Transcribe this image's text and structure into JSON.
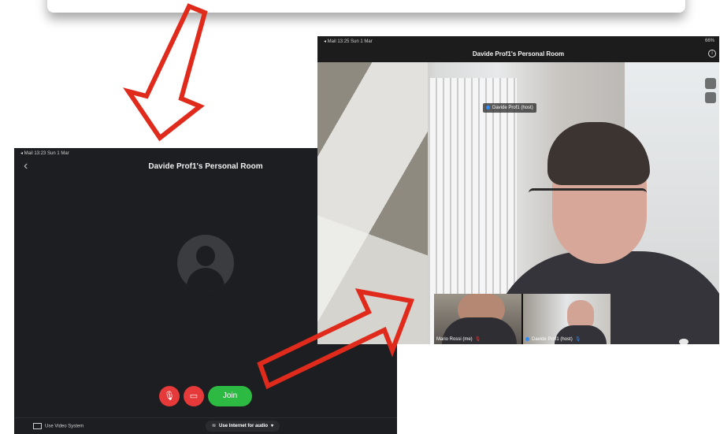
{
  "left_screen": {
    "status_left": "◂ Mail  13:23  Sun 1 Mar",
    "back_glyph": "‹",
    "title": "Davide Prof1's Personal Room",
    "join_label": "Join",
    "use_video_label": "Use Video System",
    "use_audio_label": "Use Internet for audio"
  },
  "right_screen": {
    "status_left": "◂ Mail  13:25  Sun 1 Mar",
    "status_right": "66%",
    "title": "Davide Prof1's Personal Room",
    "speaker_name": "Davide Prof1 (host)",
    "thumbnails": [
      {
        "label": "Mario Rossi (me)"
      },
      {
        "label": "Davide Prof1 (host)"
      }
    ]
  },
  "colors": {
    "arrow": "#e02a1c",
    "join_green": "#2dba42",
    "mute_red": "#e5393a",
    "dark_bg": "#1d1e21"
  }
}
